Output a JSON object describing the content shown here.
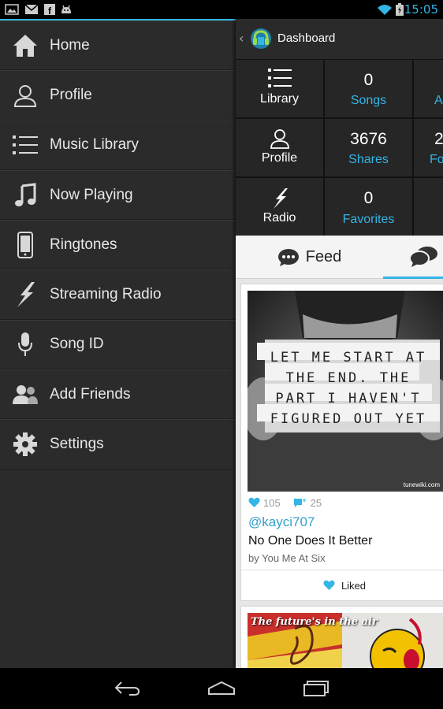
{
  "status_bar": {
    "time": "15:05",
    "icons": [
      "picture-icon",
      "gmail-icon",
      "facebook-icon",
      "android-icon",
      "wifi-icon",
      "battery-icon"
    ]
  },
  "drawer": {
    "items": [
      {
        "label": "Home",
        "icon": "home-icon"
      },
      {
        "label": "Profile",
        "icon": "profile-icon"
      },
      {
        "label": "Music Library",
        "icon": "list-icon"
      },
      {
        "label": "Now Playing",
        "icon": "music-note-icon"
      },
      {
        "label": "Ringtones",
        "icon": "phone-icon"
      },
      {
        "label": "Streaming Radio",
        "icon": "lightning-icon"
      },
      {
        "label": "Song ID",
        "icon": "microphone-icon"
      },
      {
        "label": "Add Friends",
        "icon": "friends-icon"
      },
      {
        "label": "Settings",
        "icon": "gear-icon"
      }
    ]
  },
  "action_bar": {
    "title": "Dashboard"
  },
  "dashboard": {
    "rows": [
      {
        "nav_label": "Library",
        "count": "0",
        "count_label": "Songs",
        "partial_label": "A"
      },
      {
        "nav_label": "Profile",
        "count": "3676",
        "count_label": "Shares",
        "partial_count": "2",
        "partial_label": "Fo"
      },
      {
        "nav_label": "Radio",
        "count": "0",
        "count_label": "Favorites"
      }
    ]
  },
  "tabs": {
    "feed_label": "Feed"
  },
  "feed": {
    "post": {
      "image_text_lines": [
        "LET ME START AT",
        "THE END. THE",
        "PART I HAVEN'T",
        "FIGURED OUT YET"
      ],
      "watermark": "tunewiki.com",
      "likes": "105",
      "shares": "25",
      "user": "@kayci707",
      "song": "No One Does It Better",
      "artist": "by You Me At Six",
      "liked_label": "Liked"
    },
    "post2": {
      "caption": "The future's in the air"
    }
  },
  "colors": {
    "accent": "#33b5e5",
    "drawer_bg": "#2b2b2b",
    "cell_bg": "#262626"
  }
}
